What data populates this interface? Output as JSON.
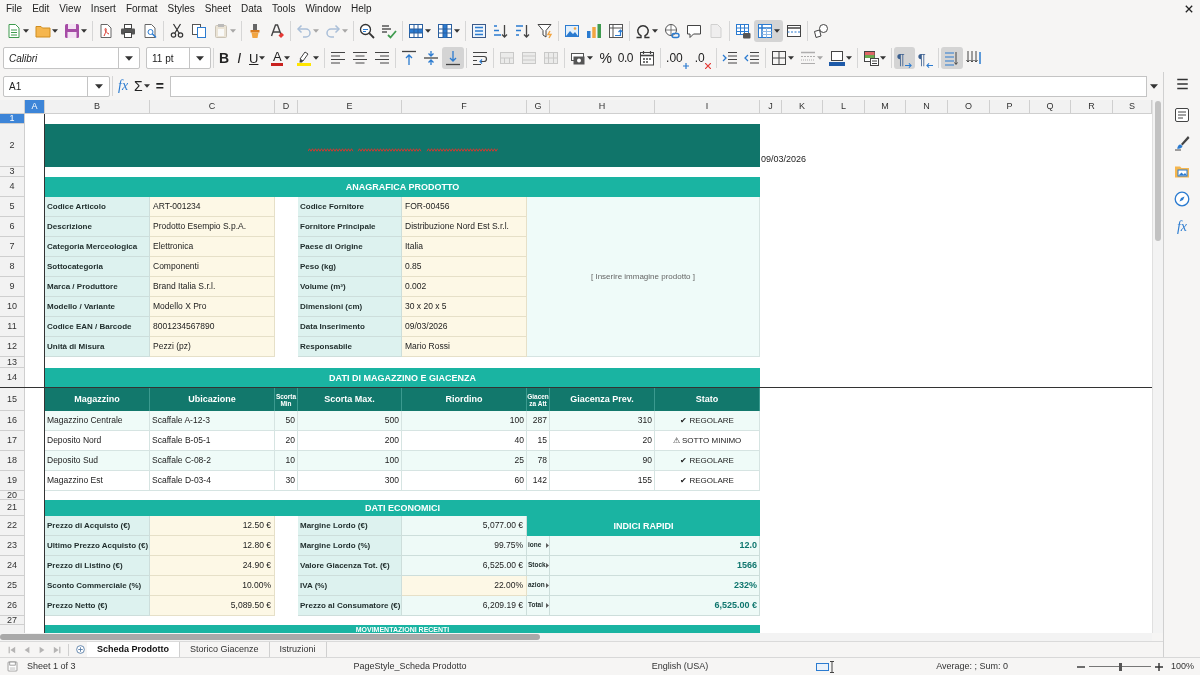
{
  "menu_bar": [
    "File",
    "Edit",
    "View",
    "Insert",
    "Format",
    "Styles",
    "Sheet",
    "Data",
    "Tools",
    "Window",
    "Help"
  ],
  "standard_toolbar": [
    {
      "pressed": false,
      "disabled": false
    },
    {
      "pressed": false,
      "disabled": false
    },
    {
      "pressed": false,
      "disabled": false
    },
    {
      "pressed": false,
      "disabled": false
    },
    {
      "pressed": false,
      "disabled": false
    },
    {
      "pressed": false,
      "disabled": false
    },
    {
      "pressed": false,
      "disabled": false
    },
    {
      "pressed": false,
      "disabled": false
    },
    {
      "pressed": false,
      "disabled": true
    },
    {
      "pressed": false,
      "disabled": false
    },
    {
      "pressed": false,
      "disabled": false
    },
    {
      "pressed": false,
      "disabled": true
    },
    {
      "pressed": false,
      "disabled": true
    },
    {
      "pressed": false,
      "disabled": false
    },
    {
      "pressed": false,
      "disabled": false
    },
    {
      "pressed": false,
      "disabled": false
    },
    {
      "pressed": false,
      "disabled": false
    },
    {
      "pressed": false,
      "disabled": false
    },
    {
      "pressed": false,
      "disabled": false
    },
    {
      "pressed": false,
      "disabled": false
    },
    {
      "pressed": false,
      "disabled": false
    },
    {
      "pressed": false,
      "disabled": false
    },
    {
      "pressed": false,
      "disabled": false
    },
    {
      "pressed": false,
      "disabled": false
    },
    {
      "pressed": false,
      "disabled": false
    },
    {
      "pressed": false,
      "disabled": false
    },
    {
      "pressed": false,
      "disabled": false
    },
    {
      "pressed": false,
      "disabled": true
    },
    {
      "pressed": false,
      "disabled": false
    },
    {
      "pressed": true,
      "disabled": false
    },
    {
      "pressed": false,
      "disabled": false
    },
    {
      "pressed": false,
      "disabled": false
    }
  ],
  "formatting_toolbar": {
    "font_name": "Calibri",
    "font_size": "11 pt",
    "buttons": [
      {
        "glyph": "B",
        "pressed": false,
        "disabled": false
      },
      {
        "glyph": "I",
        "pressed": false,
        "disabled": false
      },
      {
        "glyph": "U",
        "pressed": false,
        "disabled": false
      },
      {
        "glyph": "A",
        "pressed": false,
        "disabled": false
      },
      {
        "pressed": false,
        "disabled": false
      },
      {
        "pressed": false,
        "disabled": false
      },
      {
        "pressed": false,
        "disabled": false
      },
      {
        "pressed": false,
        "disabled": false
      },
      {
        "pressed": false,
        "disabled": false
      },
      {
        "pressed": false,
        "disabled": false
      },
      {
        "pressed": true,
        "disabled": false
      },
      {
        "pressed": false,
        "disabled": false
      },
      {
        "pressed": false,
        "disabled": true
      },
      {
        "pressed": false,
        "disabled": true
      },
      {
        "pressed": false,
        "disabled": true
      },
      {
        "pressed": false,
        "disabled": false
      },
      {
        "glyph": "%",
        "pressed": false,
        "disabled": false
      },
      {
        "glyph": "0.0",
        "pressed": false,
        "disabled": false
      },
      {
        "pressed": false,
        "disabled": false
      },
      {
        "glyph": ".00",
        "pressed": false,
        "disabled": false
      },
      {
        "glyph": ".0",
        "pressed": false,
        "disabled": false
      },
      {
        "pressed": false,
        "disabled": false
      },
      {
        "pressed": false,
        "disabled": false
      },
      {
        "pressed": false,
        "disabled": false
      },
      {
        "pressed": false,
        "disabled": true
      },
      {
        "pressed": false,
        "disabled": false
      },
      {
        "pressed": false,
        "disabled": false
      },
      {
        "glyph": "¶",
        "pressed": true,
        "disabled": false
      },
      {
        "glyph": "¶",
        "pressed": false,
        "disabled": false
      },
      {
        "pressed": true,
        "disabled": false
      },
      {
        "pressed": false,
        "disabled": false
      }
    ]
  },
  "formula_bar": {
    "cell_reference": "A1",
    "buttons": [
      "fx",
      "Σ",
      "="
    ]
  },
  "sidebar": {
    "functions_button": "fx"
  },
  "sheet": {
    "columns": [
      {
        "label": "A",
        "selected": true
      },
      {
        "label": "B",
        "selected": false
      },
      {
        "label": "C",
        "selected": false
      },
      {
        "label": "D",
        "selected": false
      },
      {
        "label": "E",
        "selected": false
      },
      {
        "label": "F",
        "selected": false
      },
      {
        "label": "G",
        "selected": false
      },
      {
        "label": "H",
        "selected": false
      },
      {
        "label": "I",
        "selected": false
      },
      {
        "label": "J",
        "selected": false
      },
      {
        "label": "K",
        "selected": false
      },
      {
        "label": "L",
        "selected": false
      },
      {
        "label": "M",
        "selected": false
      },
      {
        "label": "N",
        "selected": false
      },
      {
        "label": "O",
        "selected": false
      },
      {
        "label": "P",
        "selected": false
      },
      {
        "label": "Q",
        "selected": false
      },
      {
        "label": "R",
        "selected": false
      },
      {
        "label": "S",
        "selected": false
      }
    ],
    "rows": [
      {
        "label": "1",
        "selected": true
      },
      {
        "label": "2",
        "selected": false
      },
      {
        "label": "3",
        "selected": false
      },
      {
        "label": "4",
        "selected": false
      },
      {
        "label": "5",
        "selected": false
      },
      {
        "label": "6",
        "selected": false
      },
      {
        "label": "7",
        "selected": false
      },
      {
        "label": "8",
        "selected": false
      },
      {
        "label": "9",
        "selected": false
      },
      {
        "label": "10",
        "selected": false
      },
      {
        "label": "11",
        "selected": false
      },
      {
        "label": "12",
        "selected": false
      },
      {
        "label": "13",
        "selected": false
      },
      {
        "label": "14",
        "selected": false
      },
      {
        "label": "15",
        "selected": false
      },
      {
        "label": "16",
        "selected": false
      },
      {
        "label": "17",
        "selected": false
      },
      {
        "label": "18",
        "selected": false
      },
      {
        "label": "19",
        "selected": false
      },
      {
        "label": "20",
        "selected": false
      },
      {
        "label": "21",
        "selected": false
      },
      {
        "label": "22",
        "selected": false
      },
      {
        "label": "23",
        "selected": false
      },
      {
        "label": "24",
        "selected": false
      },
      {
        "label": "25",
        "selected": false
      },
      {
        "label": "26",
        "selected": false
      },
      {
        "label": "27",
        "selected": false
      }
    ],
    "date": "09/03/2026",
    "product_section": {
      "title": "ANAGRAFICA PRODOTTO",
      "rows": [
        {
          "left": {
            "label": "Codice Articolo",
            "value": "ART-001234"
          },
          "right": {
            "label": "Codice Fornitore",
            "value": "FOR-00456"
          }
        },
        {
          "left": {
            "label": "Descrizione",
            "value": "Prodotto Esempio S.p.A."
          },
          "right": {
            "label": "Fornitore Principale",
            "value": "Distribuzione Nord Est S.r.l."
          }
        },
        {
          "left": {
            "label": "Categoria Merceologica",
            "value": "Elettronica"
          },
          "right": {
            "label": "Paese di Origine",
            "value": "Italia"
          }
        },
        {
          "left": {
            "label": "Sottocategoria",
            "value": "Componenti"
          },
          "right": {
            "label": "Peso (kg)",
            "value": "0.85"
          }
        },
        {
          "left": {
            "label": "Marca / Produttore",
            "value": "Brand Italia S.r.l."
          },
          "right": {
            "label": "Volume (m³)",
            "value": "0.002"
          }
        },
        {
          "left": {
            "label": "Modello / Variante",
            "value": "Modello X Pro"
          },
          "right": {
            "label": "Dimensioni (cm)",
            "value": "30 x 20 x 5"
          }
        },
        {
          "left": {
            "label": "Codice EAN / Barcode",
            "value": "8001234567890"
          },
          "right": {
            "label": "Data Inserimento",
            "value": "09/03/2026"
          }
        },
        {
          "left": {
            "label": "Unità di Misura",
            "value": "Pezzi (pz)"
          },
          "right": {
            "label": "Responsabile",
            "value": "Mario Rossi"
          }
        }
      ],
      "image_placeholder": "[ Inserire immagine prodotto ]"
    },
    "stock_section": {
      "title": "DATI DI MAGAZZINO E GIACENZA",
      "columns": [
        "Magazzino",
        "Ubicazione",
        "Scorta Min",
        "Scorta Max.",
        "Riordino",
        "Giacenza Att",
        "Giacenza Prev.",
        "Stato"
      ],
      "rows": [
        [
          "Magazzino Centrale",
          "Scaffale A-12-3",
          "50",
          "500",
          "100",
          "287",
          "310",
          "✔ REGOLARE"
        ],
        [
          "Deposito Nord",
          "Scaffale B-05-1",
          "20",
          "200",
          "40",
          "15",
          "20",
          "⚠ SOTTO MINIMO"
        ],
        [
          "Deposito Sud",
          "Scaffale C-08-2",
          "10",
          "100",
          "25",
          "78",
          "90",
          "✔ REGOLARE"
        ],
        [
          "Magazzino Est",
          "Scaffale D-03-4",
          "30",
          "300",
          "60",
          "142",
          "155",
          "✔ REGOLARE"
        ]
      ]
    },
    "economic_section": {
      "title": "DATI ECONOMICI",
      "rows": [
        {
          "left": {
            "label": "Prezzo di Acquisto (€)",
            "value": "12.50 €",
            "kind": "input"
          },
          "right": {
            "label": "Margine Lordo (€)",
            "value": "5,077.00 €",
            "kind": "formula"
          }
        },
        {
          "left": {
            "label": "Ultimo Prezzo Acquisto (€)",
            "value": "12.80 €",
            "kind": "input"
          },
          "right": {
            "label": "Margine Lordo (%)",
            "value": "99.75%",
            "kind": "formula"
          }
        },
        {
          "left": {
            "label": "Prezzo di Listino (€)",
            "value": "24.90 €",
            "kind": "input"
          },
          "right": {
            "label": "Valore Giacenza Tot. (€)",
            "value": "6,525.00 €",
            "kind": "formula"
          }
        },
        {
          "left": {
            "label": "Sconto Commerciale (%)",
            "value": "10.00%",
            "kind": "input"
          },
          "right": {
            "label": "IVA (%)",
            "value": "22.00%",
            "kind": "input"
          }
        },
        {
          "left": {
            "label": "Prezzo Netto (€)",
            "value": "5,089.50 €",
            "kind": "input"
          },
          "right": {
            "label": "Prezzo al Consumatore (€)",
            "value": "6,209.19 €",
            "kind": "formula"
          }
        }
      ],
      "quick_indices": {
        "title": "INDICI RAPIDI",
        "rows": [
          {
            "label": "ione",
            "value": "12.0",
            "clipped": true
          },
          {
            "label": "Stock",
            "value": "1566",
            "clipped": true
          },
          {
            "label": "azion",
            "value": "232%",
            "clipped": true
          },
          {
            "label": "Total",
            "value": "6,525.00 €",
            "clipped": true
          }
        ]
      }
    },
    "next_section": {
      "title": "MOVIMENTAZIONI RECENTI"
    }
  },
  "sheet_navigation": [
    {
      "disabled": true
    },
    {
      "disabled": true
    },
    {
      "disabled": true
    },
    {
      "disabled": true
    }
  ],
  "sheet_tabs": [
    {
      "label": "Scheda Prodotto",
      "selected": true
    },
    {
      "label": "Storico Giacenze",
      "selected": false
    },
    {
      "label": "Istruzioni",
      "selected": false
    }
  ],
  "status_bar": {
    "sheet_position": "Sheet 1 of 3",
    "page_style": "PageStyle_Scheda Prodotto",
    "language": "English (USA)",
    "selection_summary": "Average: ; Sum: 0",
    "zoom": {
      "level": 0.5,
      "reading": "100%"
    }
  }
}
